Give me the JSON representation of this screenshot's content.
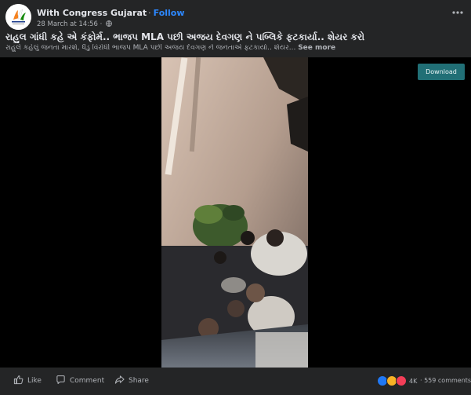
{
  "header": {
    "page_name": "With Congress Gujarat",
    "separator": "·",
    "follow_label": "Follow",
    "timestamp": "28 March at 14:56",
    "meta_separator": "·",
    "privacy_icon": "globe-icon",
    "more_icon": "more-horizontal-icon"
  },
  "post": {
    "title": "રાહુલ ગાંધી કહે એ કંફોર્મ.. ભાજપ MLA પછી અજય દેવગણ ને પબ્લિકે ફટકાર્યા.. શેયર કરો",
    "caption": "રાહુલે કહેલું જનતા મારશે, ધૈડુ વિરોધી ભાજપ MLA પછી અજય દેવગણ ને જનતાએ ફટકાર્યા.. શેયર...",
    "see_more": "See more"
  },
  "video": {
    "download_label": "Download"
  },
  "footer": {
    "like_label": "Like",
    "comment_label": "Comment",
    "share_label": "Share",
    "reaction_count": "4K",
    "separator": "·",
    "comments_count": "559 comments"
  },
  "colors": {
    "background": "#242526",
    "accent": "#2d88ff",
    "download_bg": "#216f76",
    "secondary_text": "#b0b3b8"
  }
}
